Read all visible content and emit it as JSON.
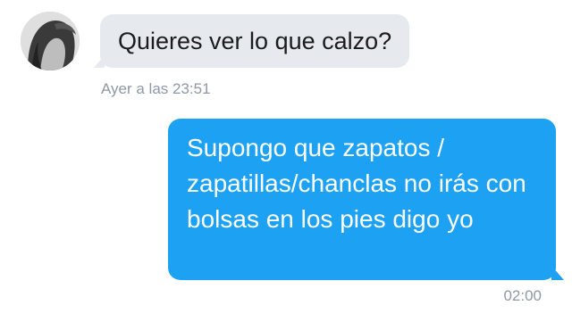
{
  "conversation": {
    "incoming": {
      "avatar": "user-avatar-photo",
      "text": "Quieres ver lo que calzo?",
      "timestamp": "Ayer a las 23:51"
    },
    "outgoing": {
      "text": "Supongo que zapatos / zapatillas/chanclas no irás con bolsas en los pies digo yo",
      "timestamp": "02:00"
    }
  },
  "colors": {
    "incoming_bubble": "#e6e9ee",
    "outgoing_bubble": "#1da1f2",
    "timestamp": "#8d99a6"
  }
}
